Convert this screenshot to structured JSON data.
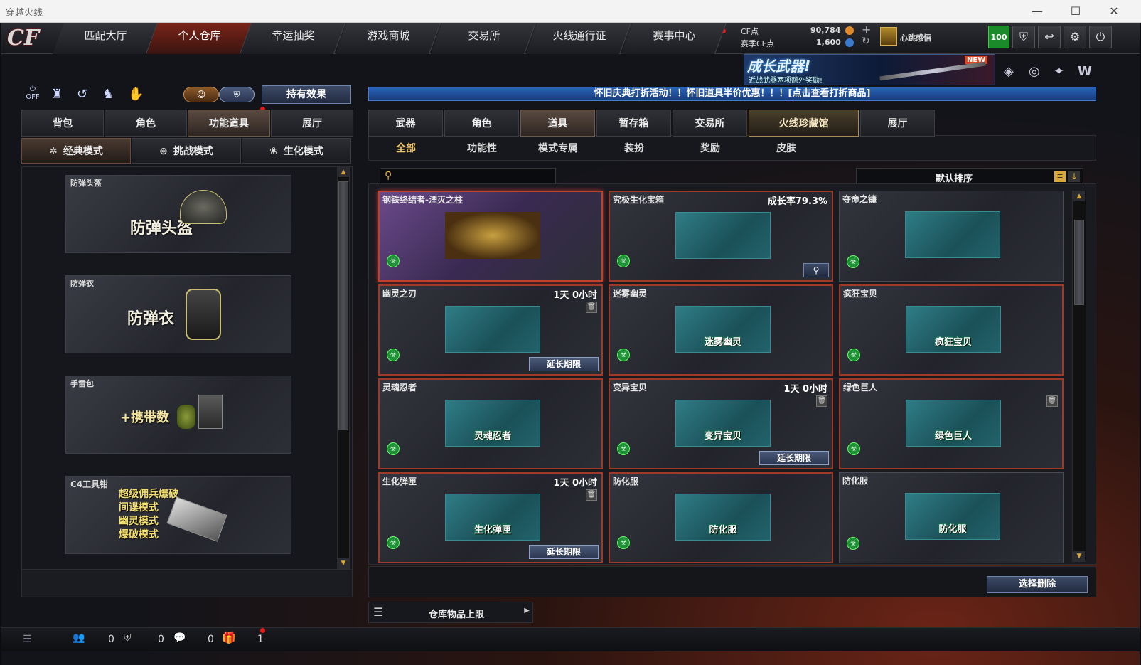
{
  "window": {
    "title": "穿越火线"
  },
  "nav": {
    "tabs": [
      "匹配大厅",
      "个人仓库",
      "幸运抽奖",
      "游戏商城",
      "交易所",
      "火线通行证",
      "赛事中心"
    ],
    "active": "个人仓库"
  },
  "currency": {
    "cf_label": "CF点",
    "cf_value": "90,784",
    "season_label": "赛季CF点",
    "season_value": "1,600",
    "username": "心跳感悟",
    "level": "100"
  },
  "banner": {
    "title": "成长武器!",
    "subtitle": "近战武器两项额外奖励!",
    "badge": "NEW"
  },
  "left": {
    "effect_button": "持有效果",
    "tabs": [
      "背包",
      "角色",
      "功能道具",
      "展厅"
    ],
    "active_tab": "功能道具",
    "modes": [
      "经典模式",
      "挑战模式",
      "生化模式"
    ],
    "active_mode": "经典模式",
    "cards": [
      {
        "label": "防弹头盔",
        "big": "防弹头盔"
      },
      {
        "label": "防弹衣",
        "big": "防弹衣"
      },
      {
        "label": "手雷包",
        "big": "+携带数"
      },
      {
        "label": "C4工具钳",
        "lines": [
          "超级佣兵爆破",
          "间谍模式",
          "幽灵模式",
          "爆破模式"
        ]
      }
    ]
  },
  "marquee": "怀旧庆典打折活动！！怀旧道具半价优惠！！！[点击查看打折商品]",
  "right": {
    "tabs": [
      "武器",
      "角色",
      "道具",
      "暂存箱",
      "交易所",
      "火线珍藏馆",
      "展厅"
    ],
    "active_tab": "道具",
    "subtabs": [
      "全部",
      "功能性",
      "模式专属",
      "装扮",
      "奖励",
      "皮肤"
    ],
    "active_subtab": "全部",
    "search_placeholder": "",
    "sort_label": "默认排序",
    "extend_label": "延长期限",
    "items": [
      {
        "name": "钢铁终结者-湮灭之柱",
        "time": "",
        "thumb": "",
        "extend": false,
        "trash": false,
        "style": "sel"
      },
      {
        "name": "究极生化宝箱",
        "time": "成长率79.3%",
        "thumb": "",
        "extend": false,
        "trash": false,
        "style": "hl",
        "magnify": true
      },
      {
        "name": "夺命之镰",
        "time": "",
        "thumb": "",
        "extend": false,
        "trash": false,
        "style": ""
      },
      {
        "name": "幽灵之刃",
        "time": "1天 0小时",
        "thumb": "",
        "extend": true,
        "trash": true,
        "style": "hl"
      },
      {
        "name": "迷雾幽灵",
        "time": "",
        "thumb": "迷雾幽灵",
        "extend": false,
        "trash": false,
        "style": "hl"
      },
      {
        "name": "疯狂宝贝",
        "time": "",
        "thumb": "疯狂宝贝",
        "extend": false,
        "trash": false,
        "style": "hl"
      },
      {
        "name": "灵魂忍者",
        "time": "",
        "thumb": "灵魂忍者",
        "extend": false,
        "trash": false,
        "style": "hl"
      },
      {
        "name": "变异宝贝",
        "time": "1天 0小时",
        "thumb": "变异宝贝",
        "extend": true,
        "trash": true,
        "style": "hl"
      },
      {
        "name": "绿色巨人",
        "time": "",
        "thumb": "绿色巨人",
        "extend": false,
        "trash": true,
        "style": "hl"
      },
      {
        "name": "生化弹匣",
        "time": "1天 0小时",
        "thumb": "生化弹匣",
        "extend": true,
        "trash": true,
        "style": "hl"
      },
      {
        "name": "防化服",
        "time": "",
        "thumb": "防化服",
        "extend": false,
        "trash": false,
        "style": "hl"
      },
      {
        "name": "防化服",
        "time": "",
        "thumb": "防化服",
        "extend": false,
        "trash": false,
        "style": ""
      }
    ],
    "delete_button": "选择删除",
    "storage_label": "仓库物品上限"
  },
  "statusbar": {
    "count1": "0",
    "count2": "0",
    "count3": "0",
    "count4": "1"
  },
  "colors": {
    "accent_red": "#c0402a",
    "teal": "#2f7d86",
    "gold": "#f0c56a"
  }
}
